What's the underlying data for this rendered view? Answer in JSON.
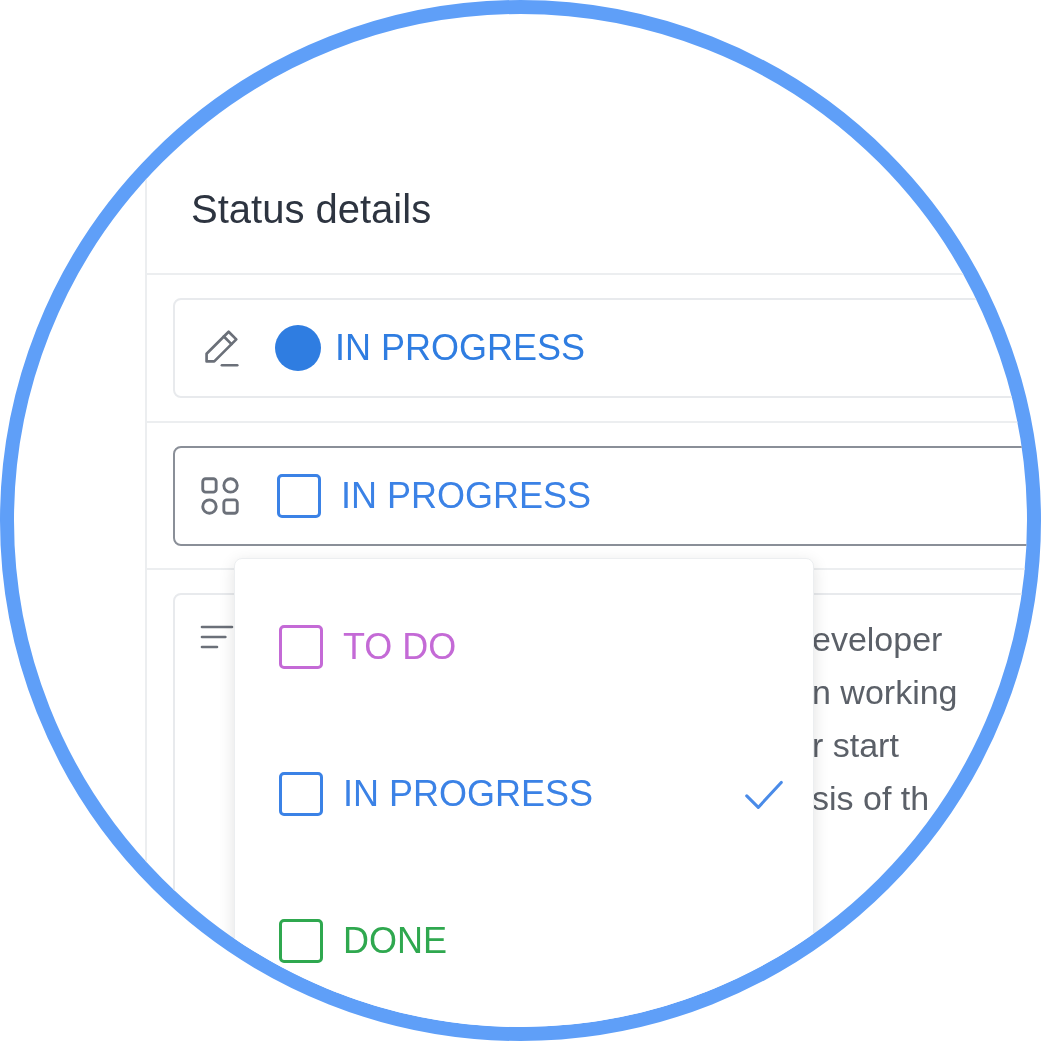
{
  "panel": {
    "title": "Status details"
  },
  "current_status": {
    "label": "IN PROGRESS",
    "color": "#2f7de1"
  },
  "status_field": {
    "value": "IN PROGRESS",
    "color": "#3b82e6",
    "expanded": true
  },
  "description": {
    "lines": [
      "eveloper",
      "n working",
      "r start",
      "sis of th"
    ]
  },
  "dropdown": {
    "options": [
      {
        "label": "TO DO",
        "color": "#c46ad6",
        "selected": false
      },
      {
        "label": "IN PROGRESS",
        "color": "#3b82e6",
        "selected": true
      },
      {
        "label": "DONE",
        "color": "#2fa84f",
        "selected": false
      }
    ]
  }
}
